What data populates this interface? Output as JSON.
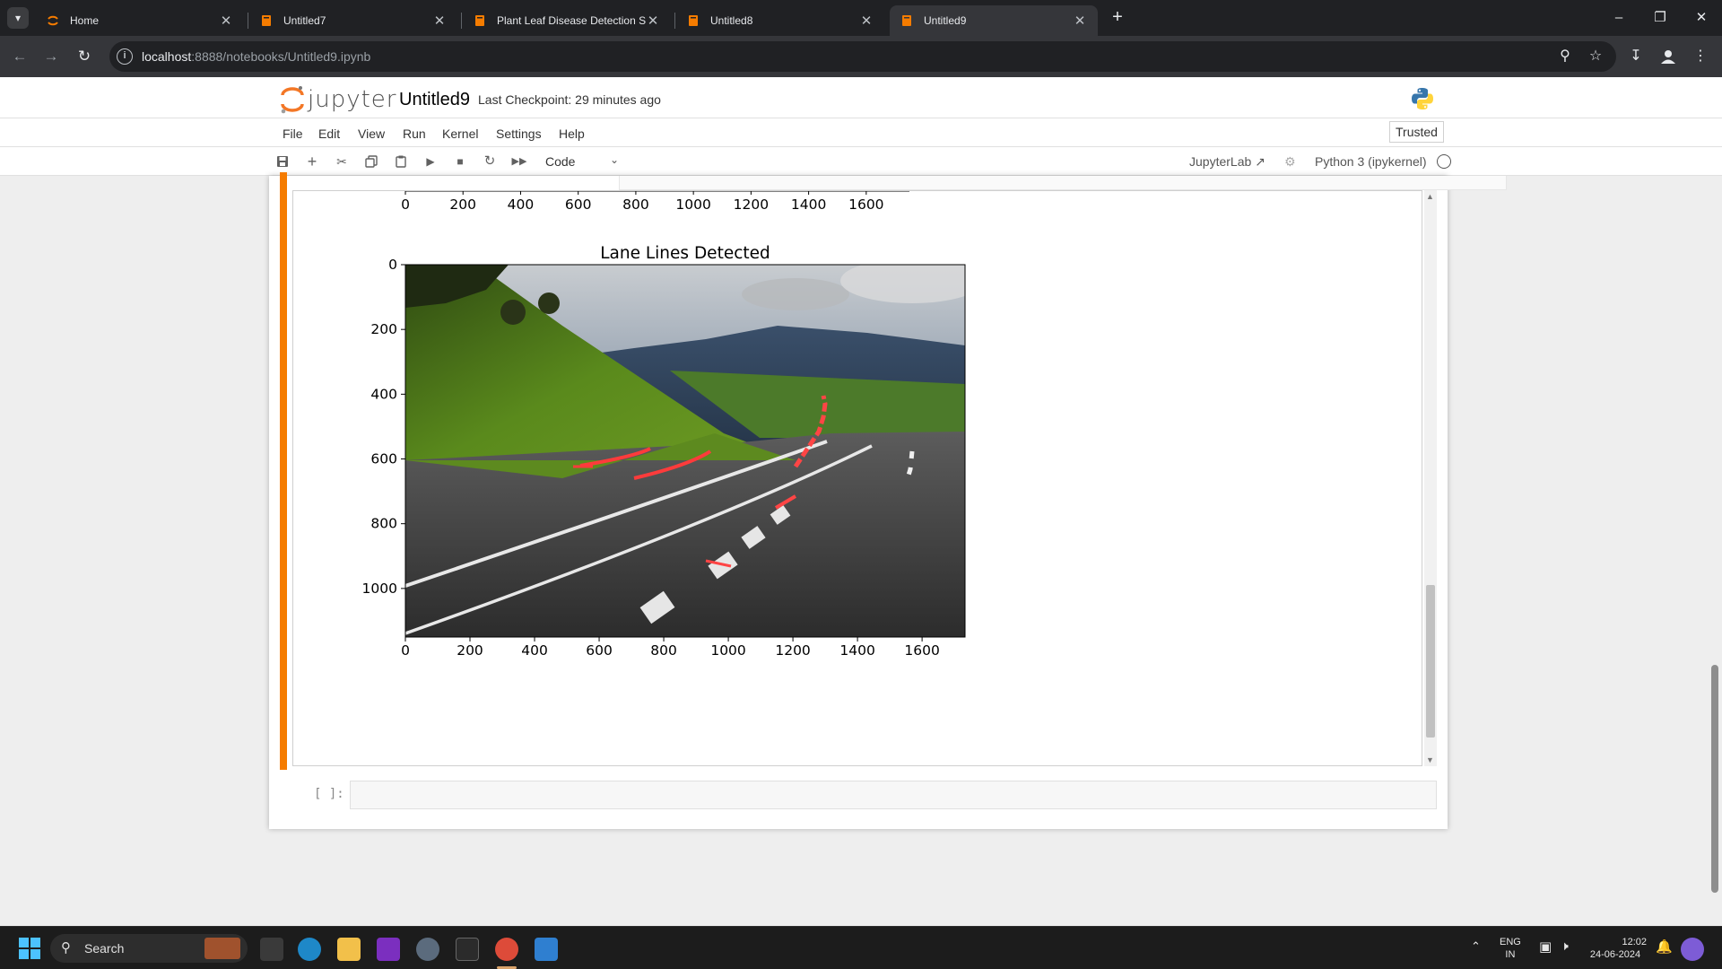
{
  "browser": {
    "tabs": [
      {
        "label": "Home",
        "active": false
      },
      {
        "label": "Untitled7",
        "active": false
      },
      {
        "label": "Plant Leaf Disease Detection Sy",
        "active": false
      },
      {
        "label": "Untitled8",
        "active": false
      },
      {
        "label": "Untitled9",
        "active": true
      }
    ],
    "url_host": "localhost",
    "url_rest": ":8888/notebooks/Untitled9.ipynb"
  },
  "jupyter": {
    "logo_text": "jupyter",
    "notebook_title": "Untitled9",
    "checkpoint": "Last Checkpoint: 29 minutes ago",
    "menu": [
      "File",
      "Edit",
      "View",
      "Run",
      "Kernel",
      "Settings",
      "Help"
    ],
    "trusted": "Trusted",
    "cell_type": "Code",
    "jupyterlab_link": "JupyterLab",
    "kernel": "Python 3 (ipykernel)",
    "empty_prompt": "[ ]:"
  },
  "chart_data": {
    "type": "image",
    "title": "Lane Lines Detected",
    "image_description_note": "",
    "x_ticks": [
      0,
      200,
      400,
      600,
      800,
      1000,
      1200,
      1400,
      1600
    ],
    "y_ticks": [
      0,
      200,
      400,
      600,
      800,
      1000
    ],
    "xlim": [
      0,
      1733
    ],
    "ylim": [
      1150,
      0
    ],
    "previous_plot_x_ticks": [
      0,
      200,
      400,
      600,
      800,
      1000,
      1200,
      1400,
      1600
    ],
    "detected_line_color": "#ff3333"
  },
  "taskbar": {
    "search_label": "Search",
    "lang_top": "ENG",
    "lang_bottom": "IN",
    "time": "12:02",
    "date": "24-06-2024"
  },
  "colors": {
    "accent_orange": "#f57c00",
    "browser_dark": "#202124"
  }
}
